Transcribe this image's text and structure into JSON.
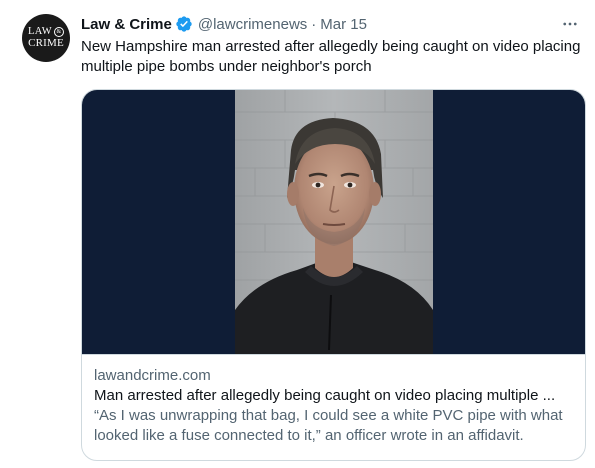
{
  "author": {
    "avatar_line1": "LAW",
    "avatar_amp": "&",
    "avatar_line2": "CRIME",
    "name": "Law & Crime",
    "handle": "@lawcrimenews",
    "separator": "·",
    "date": "Mar 15",
    "verified_icon": "verified-badge-icon"
  },
  "more_icon": "more-options-icon",
  "tweet": {
    "text": "New Hampshire man arrested after allegedly being caught on video placing multiple pipe bombs under neighbor's porch"
  },
  "card": {
    "domain": "lawandcrime.com",
    "title": "Man arrested after allegedly being caught on video placing multiple ...",
    "description": "“As I was unwrapping that bag, I could see a white PVC pipe with what looked like a fuse connected to it,” an officer wrote in an affidavit."
  },
  "colors": {
    "verified": "#1d9bf0",
    "secondary_text": "#536471",
    "card_background": "#0f1d36",
    "border": "#cfd9de"
  }
}
